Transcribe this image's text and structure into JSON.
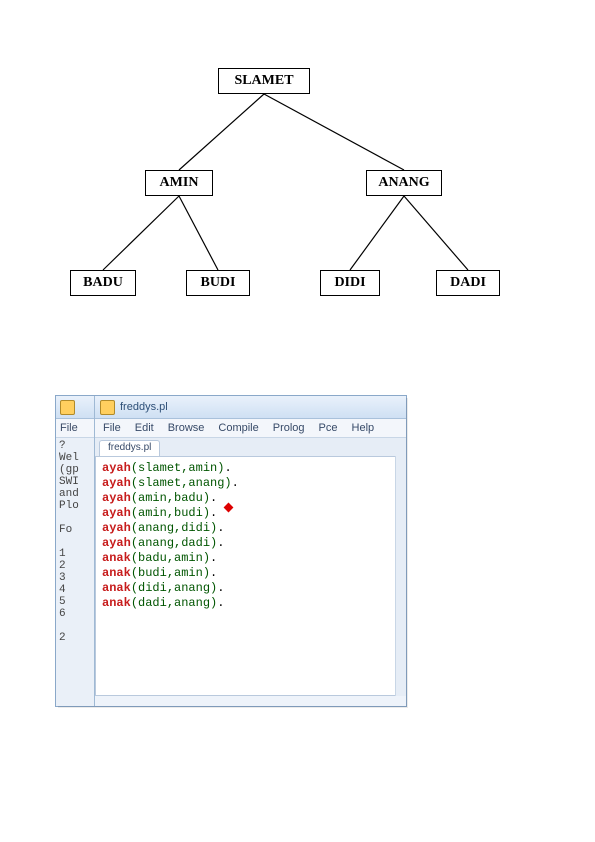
{
  "tree": {
    "root": "SLAMET",
    "mid_left": "AMIN",
    "mid_right": "ANANG",
    "leaf1": "BADU",
    "leaf2": "BUDI",
    "leaf3": "DIDI",
    "leaf4": "DADI"
  },
  "bg_window": {
    "title_fragment": "",
    "menu_file": "File",
    "body_fragment": "?\nWel\n(gp\nSWI\nand\nPlo\n\nFo\n\n1\n2\n3\n4\n5\n6\n\n2\n"
  },
  "ide": {
    "title": "freddys.pl",
    "menu": {
      "file": "File",
      "edit": "Edit",
      "browse": "Browse",
      "compile": "Compile",
      "prolog": "Prolog",
      "pce": "Pce",
      "help": "Help"
    },
    "tab": "freddys.pl",
    "code": [
      {
        "kw": "ayah",
        "args": "(slamet,amin)"
      },
      {
        "kw": "ayah",
        "args": "(slamet,anang)"
      },
      {
        "kw": "ayah",
        "args": "(amin,badu)"
      },
      {
        "kw": "ayah",
        "args": "(amin,budi)"
      },
      {
        "kw": "ayah",
        "args": "(anang,didi)"
      },
      {
        "kw": "ayah",
        "args": "(anang,dadi)"
      },
      {
        "kw": "anak",
        "args": "(badu,amin)"
      },
      {
        "kw": "anak",
        "args": "(budi,amin)"
      },
      {
        "kw": "anak",
        "args": "(didi,anang)"
      },
      {
        "kw": "anak",
        "args": "(dadi,anang)"
      }
    ]
  }
}
